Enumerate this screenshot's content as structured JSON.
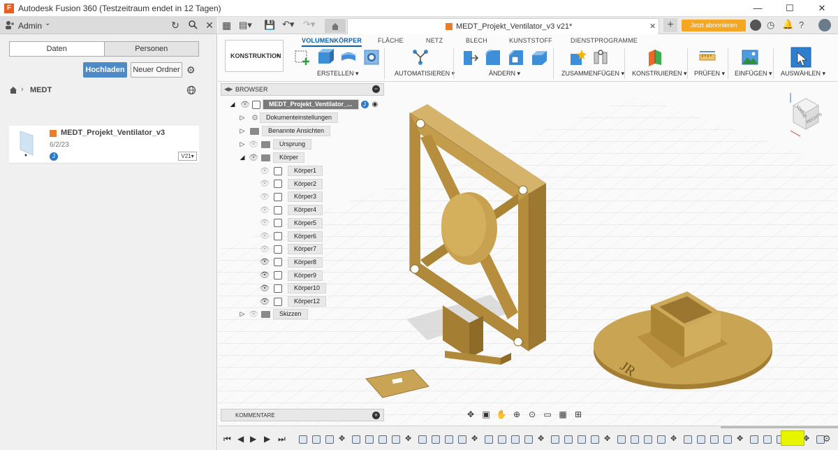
{
  "window": {
    "title": "Autodesk Fusion 360 (Testzeitraum endet in 12 Tagen)",
    "controls": [
      "—",
      "☐",
      "✕"
    ]
  },
  "left_panel": {
    "user": "Admin",
    "segments": [
      "Daten",
      "Personen"
    ],
    "upload_label": "Hochladen",
    "new_folder_label": "Neuer Ordner",
    "breadcrumb": "MEDT",
    "file": {
      "name": "MEDT_Projekt_Ventilator_v3",
      "date": "6/2/23",
      "version": "V21",
      "user_initial": "J"
    }
  },
  "tabs": {
    "doc_title": "MEDT_Projekt_Ventilator_v3 v21*",
    "subscribe_label": "Jetzt abonnieren"
  },
  "ribbon": {
    "workspace": "KONSTRUKTION",
    "tabs": [
      "VOLUMENKÖRPER",
      "FLÄCHE",
      "NETZ",
      "BLECH",
      "KUNSTSTOFF",
      "DIENSTPROGRAMME"
    ],
    "groups": [
      "ERSTELLEN",
      "AUTOMATISIEREN",
      "ÄNDERN",
      "ZUSAMMENFÜGEN",
      "KONSTRUIEREN",
      "PRÜFEN",
      "EINFÜGEN",
      "AUSWÄHLEN"
    ]
  },
  "browser": {
    "title": "BROWSER",
    "root": "MEDT_Projekt_Ventilator_...",
    "root_badge": "J",
    "items": [
      {
        "label": "Dokumenteinstellungen"
      },
      {
        "label": "Benannte Ansichten"
      },
      {
        "label": "Ursprung"
      },
      {
        "label": "Körper"
      }
    ],
    "bodies": [
      "Körper1",
      "Körper2",
      "Körper3",
      "Körper4",
      "Körper5",
      "Körper6",
      "Körper7",
      "Körper8",
      "Körper9",
      "Körper10",
      "Körper12"
    ],
    "sketches": "Skizzen"
  },
  "comments": {
    "label": "KOMMENTARE"
  },
  "viewcube": {
    "front": "VORNE",
    "right": "RECHTS"
  },
  "model_text": {
    "engraving": "JR"
  },
  "colors": {
    "accent": "#0b5fa8",
    "model": "#b8913f",
    "subscribe": "#f5a623",
    "upload": "#4f8ac8"
  }
}
